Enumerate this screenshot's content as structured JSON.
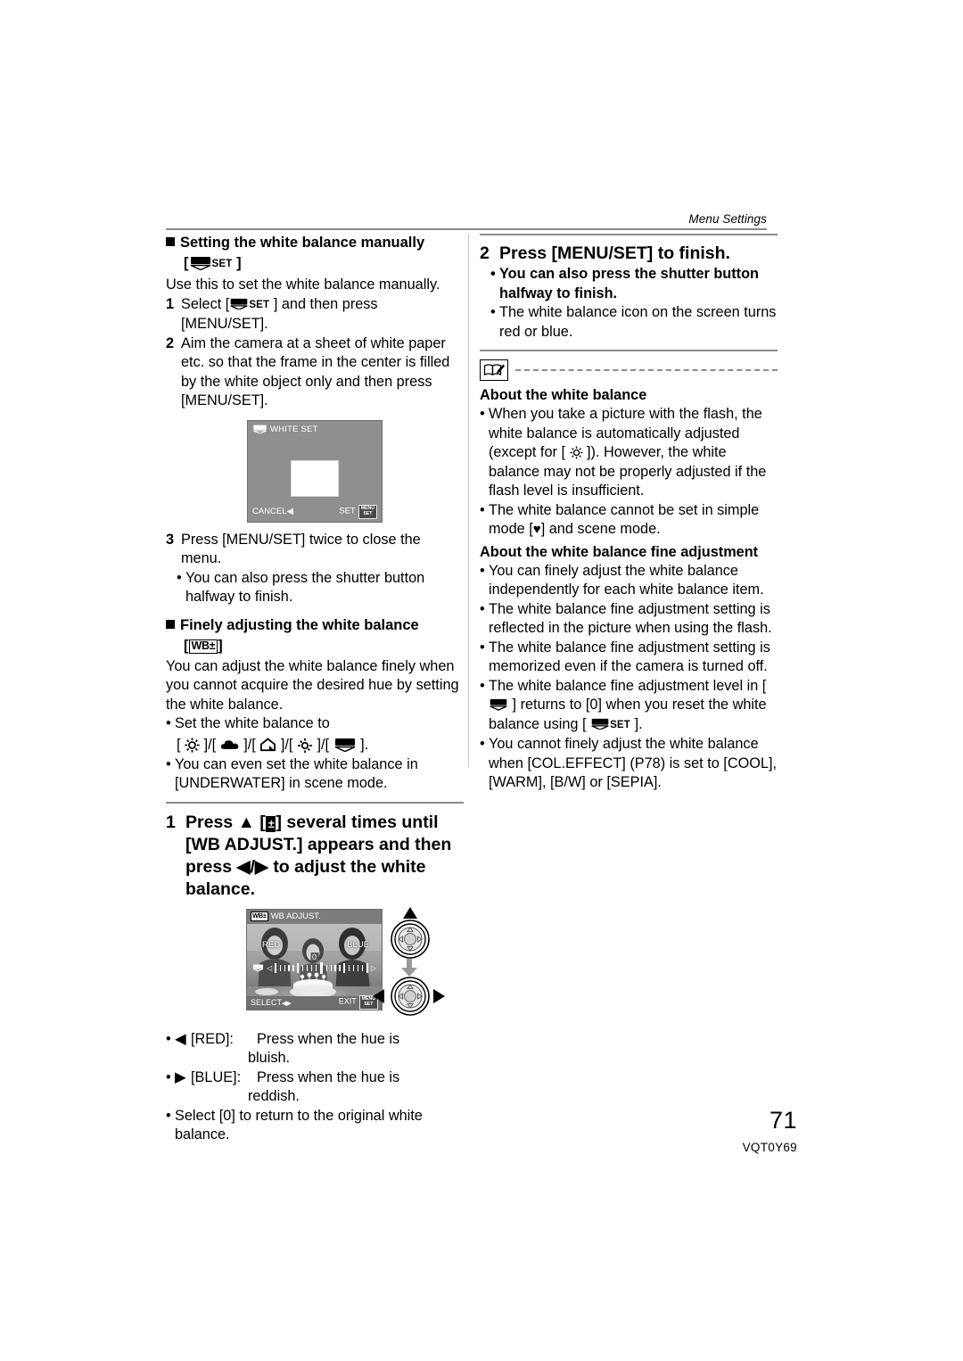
{
  "header": {
    "running_title": "Menu Settings"
  },
  "footer": {
    "page_number": "71",
    "document_id": "VQT0Y69"
  },
  "left_column": {
    "section1": {
      "heading": "Setting the white balance manually",
      "heading_bracket_open": "[",
      "heading_icon": "white-set-icon",
      "heading_icon_label": "SET",
      "heading_bracket_close": "]",
      "intro": "Use this to set the white balance manually.",
      "steps": [
        {
          "num": "1",
          "text_before": "Select [",
          "icon": "white-set-icon",
          "icon_label": "SET",
          "text_after": "] and then press [MENU/SET]."
        },
        {
          "num": "2",
          "text": "Aim the camera at a sheet of white paper etc. so that the frame in the center is filled by the white object only and then press [MENU/SET]."
        }
      ],
      "screen": {
        "title": "WHITE SET",
        "title_icon": "white-set-icon",
        "cancel_label": "CANCEL",
        "cancel_arrow": "◀",
        "set_label": "SET",
        "set_badge_line1": "MENU",
        "set_badge_line2": "SET"
      },
      "step3": {
        "num": "3",
        "text": "Press [MENU/SET] twice to close the menu."
      },
      "step3_bullet": "You can also press the shutter button halfway to finish."
    },
    "section2": {
      "heading": "Finely adjusting the white balance",
      "heading_bracket_open": "[",
      "heading_icon_label": "WB±",
      "heading_bracket_close": "]",
      "body": "You can adjust the white balance finely when you cannot acquire the desired hue by setting the white balance.",
      "bullet1": "Set the white balance to",
      "wb_icons": [
        "daylight-sun-icon",
        "cloudy-icon",
        "shade-house-icon",
        "incandescent-icon",
        "white-set-icon"
      ],
      "wb_icons_trailing": ".",
      "bullet2": "You can even set the white balance in [UNDERWATER] in scene mode."
    },
    "step_wb_adjust": {
      "num": "1",
      "text_part1": "Press",
      "up_arrow": "▲",
      "bracket_open": "[",
      "ev_icon": "exposure-compensation-icon",
      "bracket_close": "]",
      "text_part2": "several times until [WB ADJUST.] appears and then press",
      "left_arrow": "◀",
      "slash": "/",
      "right_arrow": "▶",
      "text_part3": "to adjust the white balance."
    },
    "adjust_screen": {
      "title": "WB ADJUST.",
      "title_icon_label": "WB±",
      "red_label": "RED",
      "blue_label": "BLUE",
      "value": "0",
      "slider_icon": "white-set-icon",
      "left_caret": "◁",
      "right_caret": "▷",
      "select_label": "SELECT",
      "select_arrows": "◀▶",
      "exit_label": "EXIT",
      "exit_badge_line1": "MENU",
      "exit_badge_line2": "SET",
      "cursor_pad_up": "▲",
      "cursor_pad_down": "↓",
      "cursor_pad_left": "◀",
      "cursor_pad_right": "▶"
    },
    "adjust_notes": [
      {
        "arrow": "◀",
        "key": "[RED]:",
        "value": "Press when the hue is",
        "value2": "bluish."
      },
      {
        "arrow": "▶",
        "key": "[BLUE]:",
        "value": "Press when the hue is",
        "value2": "reddish."
      }
    ],
    "adjust_note_last": "Select [0] to return to the original white balance."
  },
  "right_column": {
    "step2": {
      "num": "2",
      "text": "Press [MENU/SET] to finish.",
      "bullet_bold": "You can also press the shutter button halfway to finish.",
      "bullet_plain": "The white balance icon on the screen turns red or blue."
    },
    "note_icon": "note-book-pencil-icon",
    "note1": {
      "title": "About the white balance",
      "bullets": [
        {
          "part1": "When you take a picture with the flash, the white balance is automatically adjusted (except for [",
          "icon": "daylight-sun-icon",
          "part2": "]). However, the white balance may not be properly adjusted if the flash level is insufficient."
        },
        {
          "part1": "The white balance cannot be set in simple mode [",
          "icon": "heart-icon",
          "part2": "] and scene mode."
        }
      ]
    },
    "note2": {
      "title": "About the white balance fine adjustment",
      "bullets": [
        {
          "text": "You can finely adjust the white balance independently for each white balance item."
        },
        {
          "text": "The white balance fine adjustment setting is reflected in the picture when using the flash."
        },
        {
          "text": "The white balance fine adjustment setting is memorized even if the camera is turned off."
        },
        {
          "part1": "The white balance fine adjustment level in [",
          "icon": "white-set-icon",
          "part2": "] returns to [0] when you reset the white balance using [",
          "icon2": "white-set-icon",
          "icon2_label": "SET",
          "part3": "]."
        },
        {
          "text": "You cannot finely adjust the white balance when [COL.EFFECT] (P78) is set to [COOL], [WARM], [B/W] or [SEPIA]."
        }
      ]
    }
  }
}
